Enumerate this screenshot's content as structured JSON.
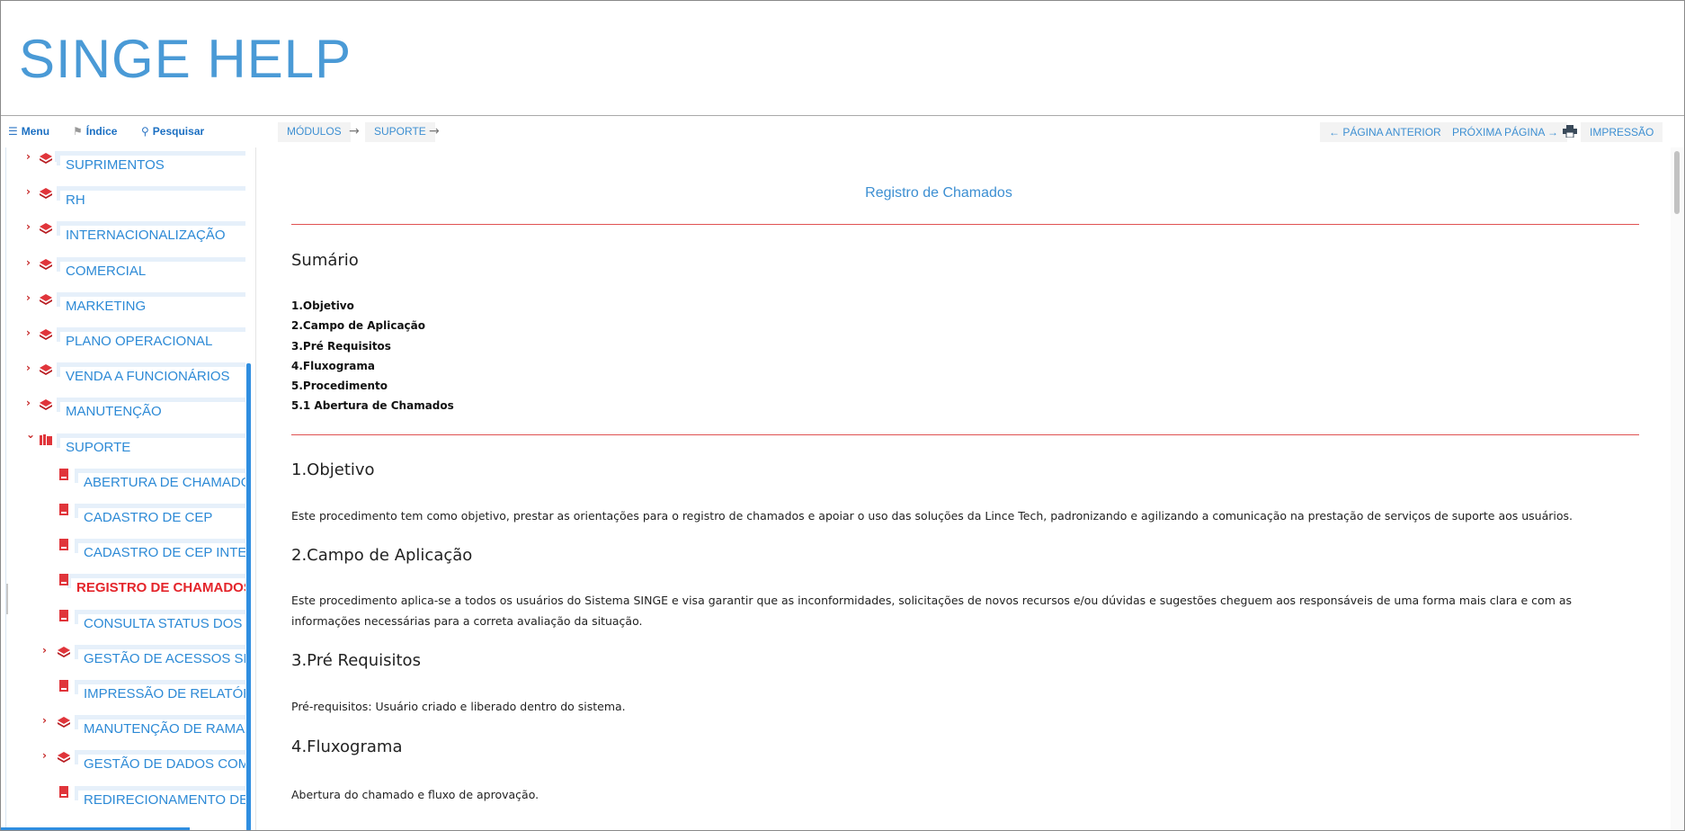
{
  "app": {
    "title": "SINGE HELP"
  },
  "toolbar": {
    "menu_label": "Menu",
    "index_label": "Índice",
    "search_label": "Pesquisar",
    "breadcrumb": [
      "MÓDULOS",
      "SUPORTE"
    ],
    "breadcrumb_sep": "→",
    "prev_label": "← PÁGINA ANTERIOR",
    "next_label": "PRÓXIMA PÁGINA →",
    "print_label": "IMPRESSÃO"
  },
  "sidebar": {
    "items": [
      {
        "label": "SUPRIMENTOS",
        "level": 0,
        "expandable": true,
        "expanded": false,
        "icon": "book-stack-icon"
      },
      {
        "label": "RH",
        "level": 0,
        "expandable": true,
        "expanded": false,
        "icon": "book-stack-icon"
      },
      {
        "label": "INTERNACIONALIZAÇÃO",
        "level": 0,
        "expandable": true,
        "expanded": false,
        "icon": "book-stack-icon"
      },
      {
        "label": "COMERCIAL",
        "level": 0,
        "expandable": true,
        "expanded": false,
        "icon": "book-stack-icon"
      },
      {
        "label": "MARKETING",
        "level": 0,
        "expandable": true,
        "expanded": false,
        "icon": "book-stack-icon"
      },
      {
        "label": "PLANO OPERACIONAL",
        "level": 0,
        "expandable": true,
        "expanded": false,
        "icon": "book-stack-icon"
      },
      {
        "label": "VENDA A FUNCIONÁRIOS",
        "level": 0,
        "expandable": true,
        "expanded": false,
        "icon": "book-stack-icon"
      },
      {
        "label": "MANUTENÇÃO",
        "level": 0,
        "expandable": true,
        "expanded": false,
        "icon": "book-stack-icon"
      },
      {
        "label": "SUPORTE",
        "level": 0,
        "expandable": true,
        "expanded": true,
        "icon": "book-open-icon"
      },
      {
        "label": "ABERTURA DE CHAMADOS",
        "level": 1,
        "expandable": false,
        "icon": "page-icon"
      },
      {
        "label": "CADASTRO DE CEP",
        "level": 1,
        "expandable": false,
        "icon": "page-icon"
      },
      {
        "label": "CADASTRO DE CEP INTERNACIONAL",
        "level": 1,
        "expandable": false,
        "icon": "page-icon"
      },
      {
        "label": "REGISTRO DE CHAMADOS",
        "level": 1,
        "expandable": false,
        "icon": "page-icon",
        "active": true
      },
      {
        "label": "CONSULTA STATUS DOS CHAMADOS",
        "level": 1,
        "expandable": false,
        "icon": "page-icon"
      },
      {
        "label": "GESTÃO DE ACESSOS SINGE",
        "level": 1,
        "expandable": true,
        "expanded": false,
        "icon": "book-stack-icon"
      },
      {
        "label": "IMPRESSÃO DE RELATÓRIOS",
        "level": 1,
        "expandable": false,
        "icon": "page-icon"
      },
      {
        "label": "MANUTENÇÃO DE RAMAIS",
        "level": 1,
        "expandable": true,
        "expanded": false,
        "icon": "book-stack-icon"
      },
      {
        "label": "GESTÃO DE DADOS COM PLANILHAS",
        "level": 1,
        "expandable": true,
        "expanded": false,
        "icon": "book-stack-icon"
      },
      {
        "label": "REDIRECIONAMENTO DE E-MAILS",
        "level": 1,
        "expandable": false,
        "icon": "page-icon"
      }
    ]
  },
  "document": {
    "title": "Registro de Chamados",
    "summary_heading": "Sumário",
    "toc": [
      "1.Objetivo",
      "2.Campo de Aplicação",
      "3.Pré Requisitos",
      "4.Fluxograma",
      "5.Procedimento",
      "5.1 Abertura de Chamados"
    ],
    "sections": [
      {
        "heading": "1.Objetivo",
        "text": "Este procedimento tem como objetivo, prestar as orientações para o registro de chamados e apoiar o uso das soluções da Lince Tech, padronizando e agilizando a comunicação na prestação de serviços de suporte aos usuários."
      },
      {
        "heading": "2.Campo de Aplicação",
        "text": "Este procedimento aplica-se a todos os usuários do Sistema SINGE e visa garantir que as inconformidades, solicitações de novos recursos e/ou dúvidas e sugestões cheguem aos responsáveis de uma forma mais clara e com as informações necessárias para a correta avaliação da situação."
      },
      {
        "heading": "3.Pré Requisitos",
        "text": "Pré-requisitos: Usuário criado e liberado dentro do sistema."
      },
      {
        "heading": "4.Fluxograma",
        "text": "Abertura do chamado e fluxo de aprovação."
      }
    ]
  },
  "colors": {
    "accent": "#3d8fd2",
    "active": "#e4252b",
    "rule": "#e05252",
    "scroll": "#2f8ee0"
  }
}
